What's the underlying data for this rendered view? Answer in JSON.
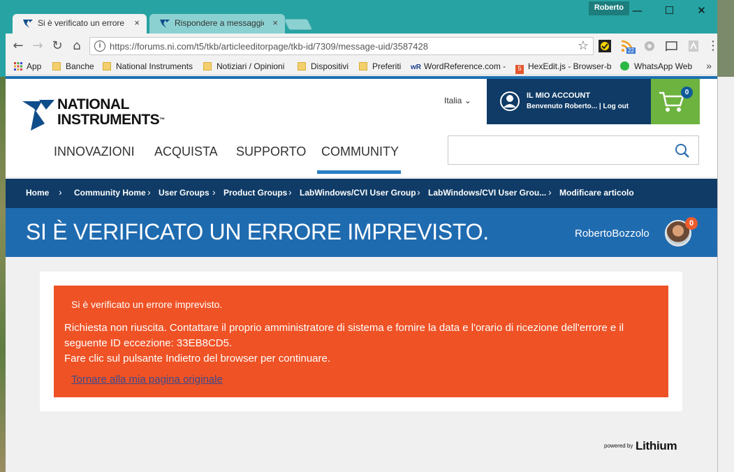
{
  "browser": {
    "profile_name": "Roberto",
    "tabs": [
      {
        "title": "Si è verificato un errore imprevisto.",
        "close": "×"
      },
      {
        "title": "Rispondere a messaggio",
        "close": "×"
      }
    ],
    "url": "https://forums.ni.com/t5/tkb/articleeditorpage/tkb-id/7309/message-uid/3587428",
    "window_controls": {
      "minimize": "—",
      "maximize": "☐",
      "close": "✕"
    },
    "nav": {
      "back": "←",
      "forward": "→",
      "reload": "↻",
      "home": "⌂"
    },
    "info_icon": "i",
    "star": "☆",
    "ext_badge": "22",
    "menu": "⋮"
  },
  "bookmarks": [
    {
      "label": "App",
      "icon": "apps-grid-icon"
    },
    {
      "label": "Banche",
      "icon": "folder-icon"
    },
    {
      "label": "National Instruments",
      "icon": "folder-icon"
    },
    {
      "label": "Notiziari / Opinioni",
      "icon": "folder-icon"
    },
    {
      "label": "Dispositivi",
      "icon": "folder-icon"
    },
    {
      "label": "Preferiti",
      "icon": "folder-icon"
    },
    {
      "label": "WordReference.com -",
      "icon": "wordreference-icon"
    },
    {
      "label": "HexEdit.js - Browser-b",
      "icon": "html5-icon"
    },
    {
      "label": "WhatsApp Web",
      "icon": "whatsapp-icon"
    }
  ],
  "bookmarks_more": "»",
  "site": {
    "logo_line1": "NATIONAL",
    "logo_line2": "INSTRUMENTS",
    "logo_tm": "™",
    "language": "Italia",
    "account_title": "IL MIO ACCOUNT",
    "account_sub": "Benvenuto Roberto... | Log out",
    "cart_count": "0",
    "nav": [
      "INNOVAZIONI",
      "ACQUISTA",
      "SUPPORTO",
      "COMMUNITY"
    ],
    "active_nav": "COMMUNITY",
    "breadcrumb": [
      "Home",
      "Community Home",
      "User Groups",
      "Product Groups",
      "LabWindows/CVI User Group",
      "LabWindows/CVI User Grou...",
      "Modificare articolo"
    ],
    "page_title": "SI È VERIFICATO UN ERRORE IMPREVISTO.",
    "username": "RobertoBozzolo",
    "notif_count": "0"
  },
  "error": {
    "heading": "Si è verificato un errore imprevisto.",
    "line1": "Richiesta non riuscita. Contattare il proprio amministratore di sistema e fornire la data e l'orario di ricezione dell'errore e il seguente ID eccezione: 33EB8CD5.",
    "line2": "Fare clic sul pulsante Indietro del browser per continuare.",
    "link": "Tornare alla mia pagina originale"
  },
  "footer": {
    "powered_by": "powered by",
    "brand": "Lithium"
  },
  "colors": {
    "titlebar": "#27a3a3",
    "nav_dark": "#0f3b66",
    "title_blue": "#1f6bb0",
    "error": "#ef5225",
    "cart": "#6db33f"
  }
}
